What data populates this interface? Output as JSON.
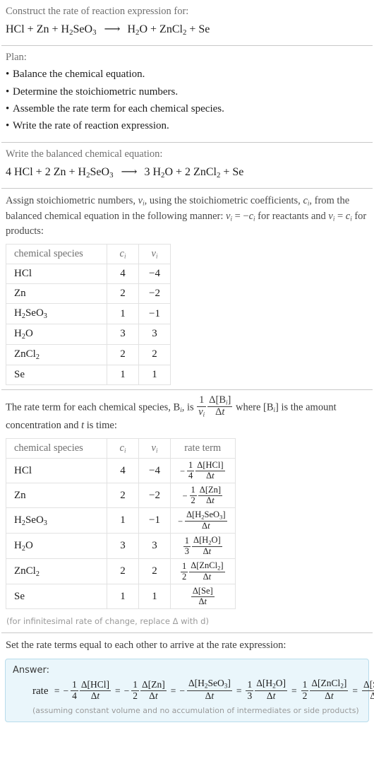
{
  "prompt": {
    "line": "Construct the rate of reaction expression for:",
    "equation": {
      "reactants": [
        "HCl",
        "Zn",
        "H2SeO3"
      ],
      "products": [
        "H2O",
        "ZnCl2",
        "Se"
      ],
      "text": "HCl + Zn + H_2SeO_3  ⟶  H_2O + ZnCl_2 + Se"
    }
  },
  "plan": {
    "heading": "Plan:",
    "items": [
      "Balance the chemical equation.",
      "Determine the stoichiometric numbers.",
      "Assemble the rate term for each chemical species.",
      "Write the rate of reaction expression."
    ]
  },
  "balanced": {
    "heading": "Write the balanced chemical equation:",
    "text": "4 HCl + 2 Zn + H_2SeO_3  ⟶  3 H_2O + 2 ZnCl_2 + Se",
    "coefficients": {
      "HCl": 4,
      "Zn": 2,
      "H2SeO3": 1,
      "H2O": 3,
      "ZnCl2": 2,
      "Se": 1
    }
  },
  "assign": {
    "text_part1": "Assign stoichiometric numbers, ",
    "text_part2": ", using the stoichiometric coefficients, ",
    "text_part3": ", from the balanced chemical equation in the following manner: ",
    "text_part4": " for reactants and ",
    "text_part5": " for products:"
  },
  "table1": {
    "headers": [
      "chemical species",
      "c",
      "v"
    ],
    "rows": [
      {
        "species": "HCl",
        "species_sub": "",
        "c": "4",
        "v": "−4"
      },
      {
        "species": "Zn",
        "species_sub": "",
        "c": "2",
        "v": "−2"
      },
      {
        "species": "H2SeO3",
        "species_sub": "",
        "c": "1",
        "v": "−1"
      },
      {
        "species": "H2O",
        "species_sub": "",
        "c": "3",
        "v": "3"
      },
      {
        "species": "ZnCl2",
        "species_sub": "",
        "c": "2",
        "v": "2"
      },
      {
        "species": "Se",
        "species_sub": "",
        "c": "1",
        "v": "1"
      }
    ]
  },
  "rateterm_intro": {
    "part1": "The rate term for each chemical species, B",
    "part2": ", is ",
    "part3": " where [B",
    "part4": "] is the amount concentration and ",
    "part5": " is time:"
  },
  "table2": {
    "headers": [
      "chemical species",
      "c",
      "v",
      "rate term"
    ],
    "rows": [
      {
        "species": "HCl",
        "c": "4",
        "v": "−4",
        "sign": "−",
        "coef_num": "1",
        "coef_den": "4",
        "delta": "Δ[HCl]",
        "dt": "Δt"
      },
      {
        "species": "Zn",
        "c": "2",
        "v": "−2",
        "sign": "−",
        "coef_num": "1",
        "coef_den": "2",
        "delta": "Δ[Zn]",
        "dt": "Δt"
      },
      {
        "species": "H2SeO3",
        "c": "1",
        "v": "−1",
        "sign": "−",
        "coef_num": "",
        "coef_den": "",
        "delta": "Δ[H2SeO3]",
        "dt": "Δt"
      },
      {
        "species": "H2O",
        "c": "3",
        "v": "3",
        "sign": "",
        "coef_num": "1",
        "coef_den": "3",
        "delta": "Δ[H2O]",
        "dt": "Δt"
      },
      {
        "species": "ZnCl2",
        "c": "2",
        "v": "2",
        "sign": "",
        "coef_num": "1",
        "coef_den": "2",
        "delta": "Δ[ZnCl2]",
        "dt": "Δt"
      },
      {
        "species": "Se",
        "c": "1",
        "v": "1",
        "sign": "",
        "coef_num": "",
        "coef_den": "",
        "delta": "Δ[Se]",
        "dt": "Δt"
      }
    ]
  },
  "infinitesimal_note": "(for infinitesimal rate of change, replace Δ with d)",
  "final": {
    "heading": "Set the rate terms equal to each other to arrive at the rate expression:",
    "answer_label": "Answer:",
    "rate_word": "rate",
    "equals": "=",
    "terms": [
      {
        "sign": "−",
        "num": "1",
        "den": "4",
        "delta": "Δ[HCl]",
        "dt": "Δt"
      },
      {
        "sign": "−",
        "num": "1",
        "den": "2",
        "delta": "Δ[Zn]",
        "dt": "Δt"
      },
      {
        "sign": "−",
        "num": "",
        "den": "",
        "delta": "Δ[H2SeO3]",
        "dt": "Δt"
      },
      {
        "sign": "",
        "num": "1",
        "den": "3",
        "delta": "Δ[H2O]",
        "dt": "Δt"
      },
      {
        "sign": "",
        "num": "1",
        "den": "2",
        "delta": "Δ[ZnCl2]",
        "dt": "Δt"
      },
      {
        "sign": "",
        "num": "",
        "den": "",
        "delta": "Δ[Se]",
        "dt": "Δt"
      }
    ],
    "assumption": "(assuming constant volume and no accumulation of intermediates or side products)"
  },
  "colors": {
    "answer_bg": "#eaf6fb",
    "answer_border": "#b8dceb",
    "rule": "#c8c8c8",
    "muted_text": "#6f6f6f",
    "body_text": "#1c1c1c"
  }
}
